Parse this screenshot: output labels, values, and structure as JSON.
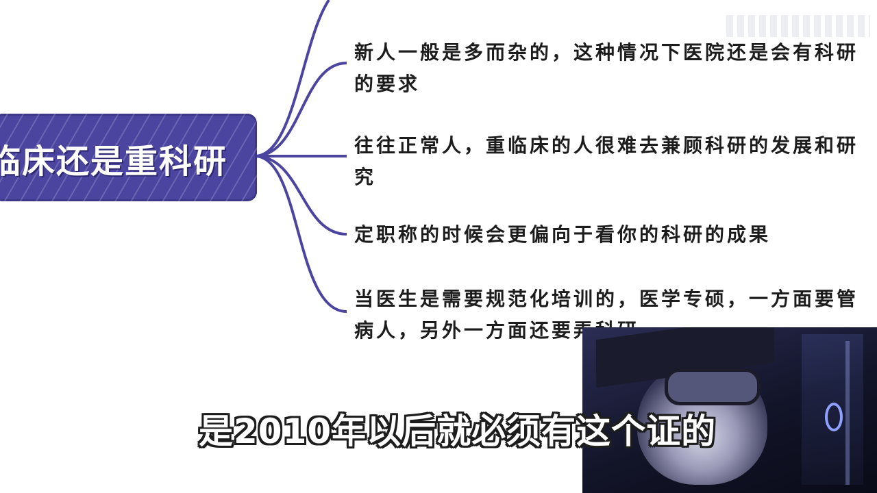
{
  "mindmap": {
    "center": {
      "title": "临床还是重科研"
    },
    "branches": [
      {
        "text": "新人一般是多而杂的，这种情况下医院还是会有科研的要求"
      },
      {
        "text": "往往正常人，重临床的人很难去兼顾科研的发展和研究"
      },
      {
        "text": "定职称的时候会更偏向于看你的科研的成果"
      },
      {
        "text": "当医生是需要规范化培训的，医学专硕，一方面要管病人，另外一方面还要弄科研"
      }
    ]
  },
  "subtitle": {
    "text": "是2010年以后就必须有这个证的"
  },
  "colors": {
    "node_fill": "#4b45a0",
    "branch_line": "#4b45a0",
    "text": "#1c1c1c",
    "subtitle_fill": "#ffffff",
    "subtitle_outline": "#1d1d1d"
  },
  "video": {
    "icon": "red-panda-character-icon"
  }
}
